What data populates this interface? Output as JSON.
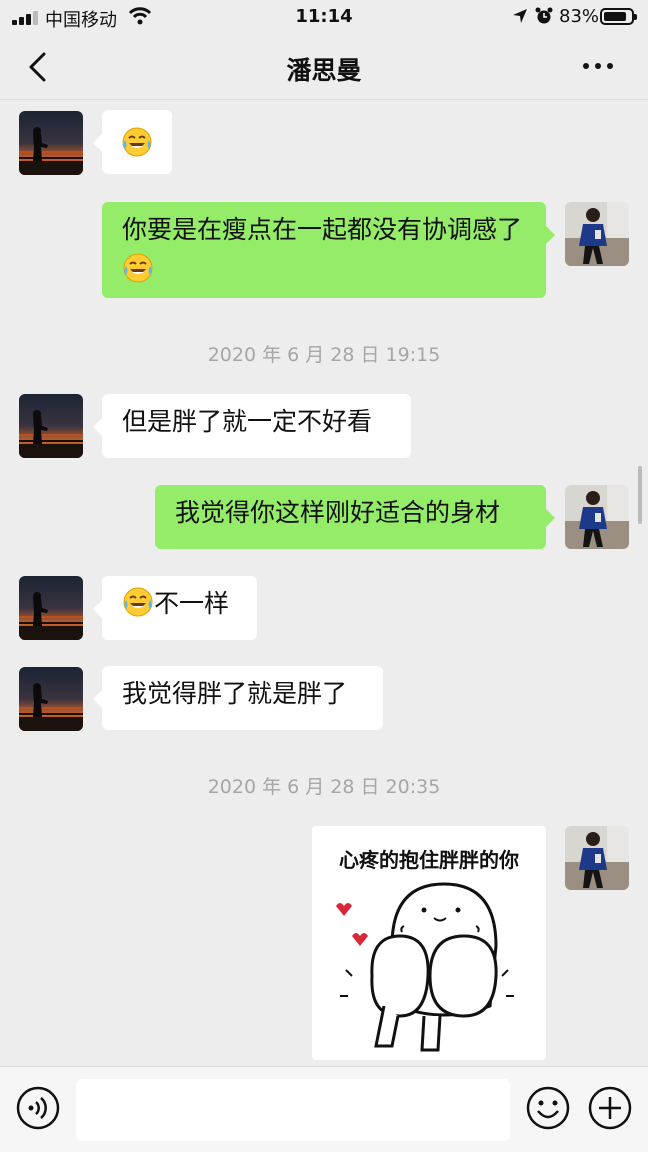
{
  "status_bar": {
    "carrier": "中国移动",
    "time": "11:14",
    "battery_percent": "83%",
    "battery_level": 0.83,
    "icons": [
      "signal-icon",
      "wifi-icon",
      "location-icon",
      "alarm-icon",
      "battery-icon"
    ]
  },
  "nav": {
    "title": "潘思曼",
    "icons": [
      "back-chevron-icon",
      "more-dots-icon"
    ]
  },
  "messages": {
    "m1_emoji": "face-with-tears-of-joy",
    "m2_text": "你要是在瘦点在一起都没有协调感了",
    "m2_emoji": "face-with-tears-of-joy",
    "ts1": "2020 年 6 月 28 日 19:15",
    "m3_text": "但是胖了就一定不好看",
    "m4_text": "我觉得你这样刚好适合的身材",
    "m5_emoji": "face-with-tears-of-joy",
    "m5_text": "不一样",
    "m6_text": "我觉得胖了就是胖了",
    "ts2": "2020 年 6 月 28 日 20:35",
    "sticker_caption": "心疼的抱住胖胖的你"
  },
  "input_bar": {
    "value": "",
    "icons": [
      "voice-icon",
      "emoji-icon",
      "plus-icon"
    ]
  },
  "colors": {
    "background": "#ededed",
    "outgoing_bubble": "#95ec69",
    "incoming_bubble": "#ffffff",
    "timestamp": "#a6a6a6"
  }
}
